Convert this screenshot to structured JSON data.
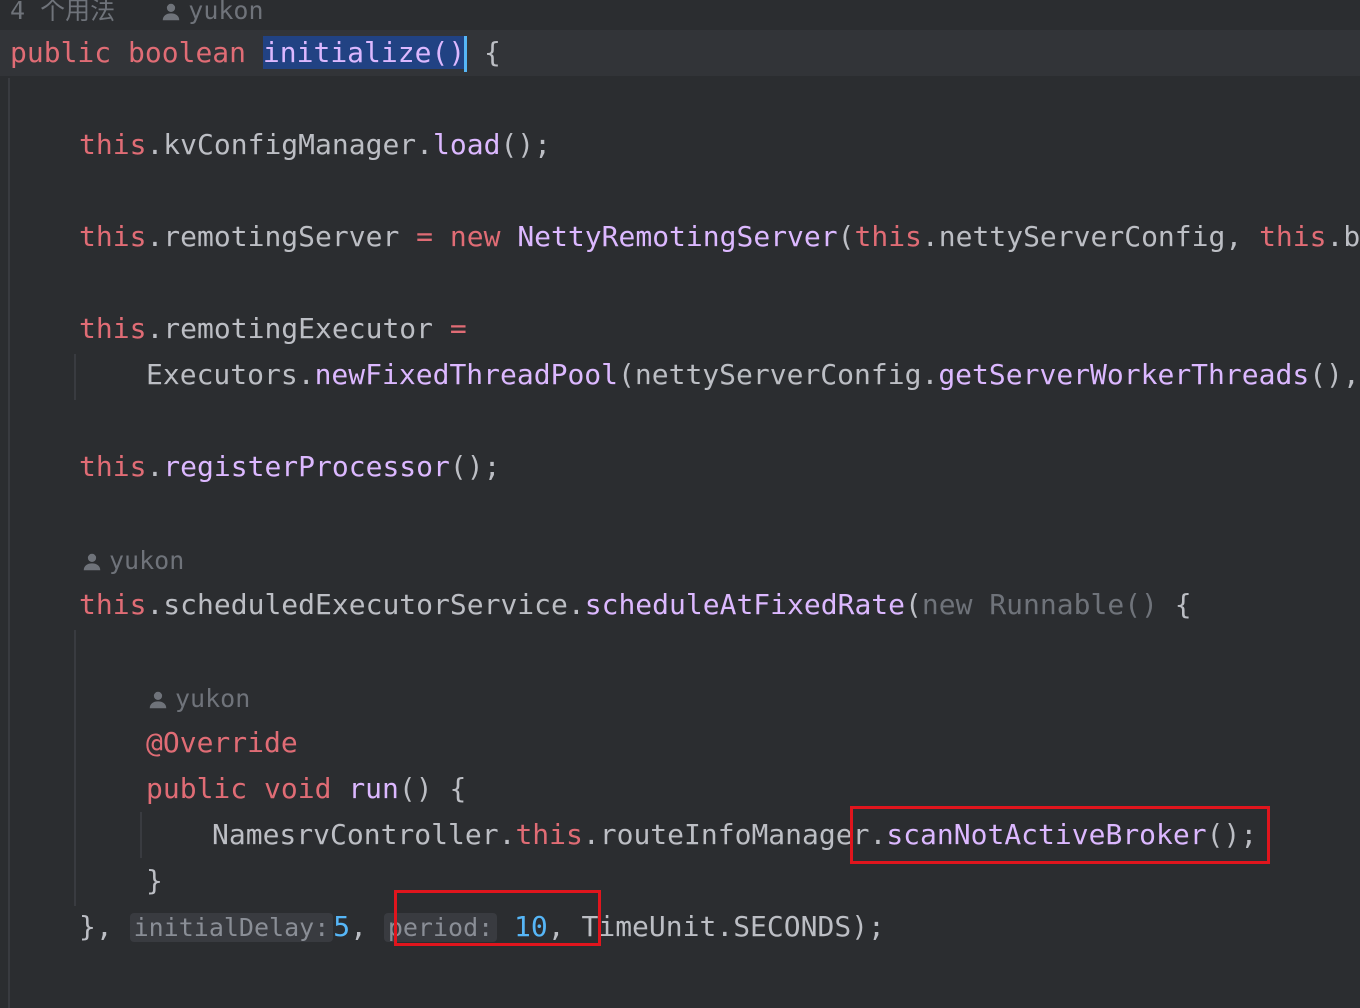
{
  "header": {
    "usages": "4 个用法",
    "author": "yukon"
  },
  "code": {
    "l1": {
      "k1": "public",
      "k2": "boolean",
      "name": "initialize",
      "parens": "()",
      "brace": " {"
    },
    "l2": {
      "this": "this",
      "field": ".kvConfigManager.",
      "call": "load",
      "rest": "();"
    },
    "l3": {
      "this": "this",
      "field": ".remotingServer",
      "eq": " = ",
      "new": "new",
      "cls": "NettyRemotingServer",
      "open": "(",
      "this2": "this",
      "arg": ".nettyServerConfig, ",
      "this3": "this",
      "cut": ".br"
    },
    "l4": {
      "this": "this",
      "field": ".remotingExecutor",
      "eq": " ="
    },
    "l5": {
      "obj": "Executors.",
      "call": "newFixedThreadPool",
      "open": "(nettyServerConfig.",
      "call2": "getServerWorkerThreads",
      "rest": "(),"
    },
    "l6": {
      "this": "this",
      "dot": ".",
      "call": "registerProcessor",
      "rest": "();"
    },
    "l7": {
      "author": "yukon"
    },
    "l8": {
      "this": "this",
      "field": ".scheduledExecutorService.",
      "call": "scheduleAtFixedRate",
      "open": "(",
      "new": "new",
      "type": "Runnable()",
      "rest": " {"
    },
    "l9": {
      "author": "yukon"
    },
    "l10": {
      "ann": "@Override"
    },
    "l11": {
      "k1": "public",
      "k2": "void",
      "name": "run",
      "rest": "() {"
    },
    "l12": {
      "obj": "NamesrvController.",
      "this": "this",
      "field": ".routeInfoManager.",
      "call": "scanNotActiveBroker",
      "rest": "();"
    },
    "l13": {
      "brace": "}"
    },
    "l14": {
      "close": "}, ",
      "hint1": "initialDelay:",
      "v1": "5",
      "comma1": ", ",
      "hint2": "period:",
      "v2": "10",
      "comma2": ", ",
      "rest": "TimeUnit.SECONDS);"
    }
  },
  "colors": {
    "highlight_box": "#e0151d",
    "background": "#2b2d30"
  }
}
